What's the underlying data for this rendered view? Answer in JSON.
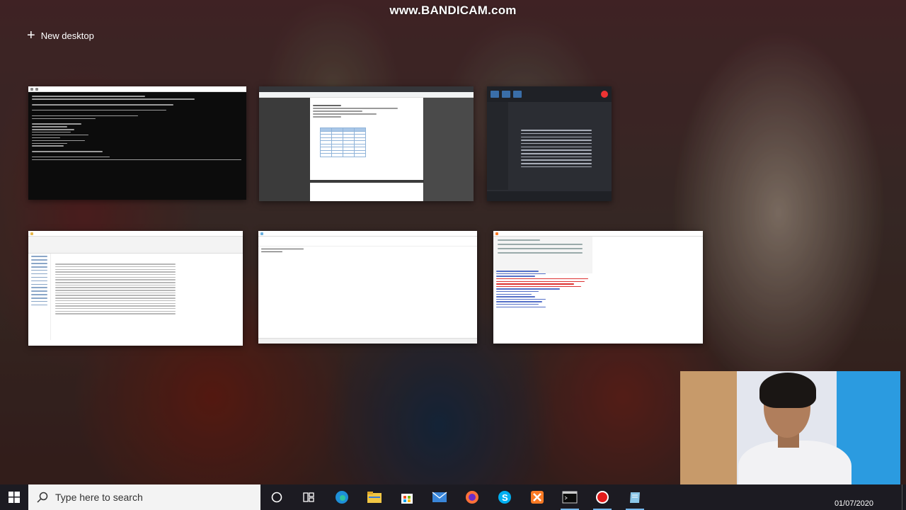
{
  "watermark": "www.BANDICAM.com",
  "task_view": {
    "new_desktop_label": "New desktop"
  },
  "windows": [
    {
      "app": "console",
      "icon": "console-window-thumbnail"
    },
    {
      "app": "browser",
      "icon": "browser-window-thumbnail"
    },
    {
      "app": "bandicam",
      "icon": "bandicam-window-thumbnail"
    },
    {
      "app": "file-explorer",
      "icon": "explorer-window-thumbnail"
    },
    {
      "app": "notepad",
      "icon": "notepad-window-thumbnail"
    },
    {
      "app": "xampp-control-panel",
      "icon": "xampp-window-thumbnail"
    }
  ],
  "taskbar": {
    "search_placeholder": "Type here to search",
    "date": "01/07/2020",
    "pinned": [
      {
        "name": "cortana-icon",
        "color": "#ffffff"
      },
      {
        "name": "task-view-icon",
        "color": "#ffffff"
      },
      {
        "name": "edge-icon",
        "color": "#1e90d8"
      },
      {
        "name": "file-explorer-icon",
        "color": "#f2c744"
      },
      {
        "name": "store-icon",
        "color": "#2b7de0"
      },
      {
        "name": "mail-icon",
        "color": "#3a86d9"
      },
      {
        "name": "firefox-icon",
        "color": "#ff7139"
      },
      {
        "name": "skype-icon",
        "color": "#00aff0"
      },
      {
        "name": "xampp-icon",
        "color": "#fb7a24"
      },
      {
        "name": "terminal-icon",
        "color": "#cccccc"
      },
      {
        "name": "bandicam-record-icon",
        "color": "#e21b1b"
      },
      {
        "name": "notepad-icon",
        "color": "#8ac6e8"
      }
    ]
  }
}
